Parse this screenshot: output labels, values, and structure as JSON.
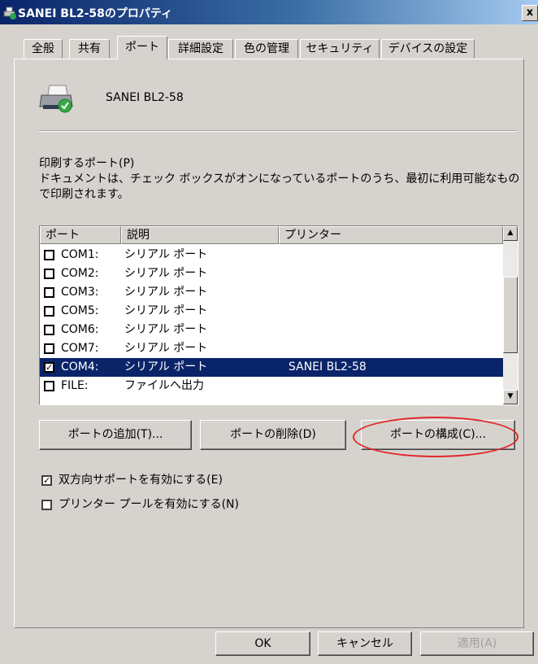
{
  "window": {
    "title": "SANEI BL2-58のプロパティ",
    "close_glyph": "x"
  },
  "tabs": [
    {
      "label": "全般"
    },
    {
      "label": "共有"
    },
    {
      "label": "ポート"
    },
    {
      "label": "詳細設定"
    },
    {
      "label": "色の管理"
    },
    {
      "label": "セキュリティ"
    },
    {
      "label": "デバイスの設定"
    }
  ],
  "active_tab": "ポート",
  "printer": {
    "name": "SANEI BL2-58",
    "icon": "printer-icon"
  },
  "ports_section": {
    "label": "印刷するポート(P)",
    "desc_line1": "ドキュメントは、チェック ボックスがオンになっているポートのうち、最初に利用可能なもの",
    "desc_line2": "で印刷されます。"
  },
  "port_list": {
    "columns": [
      "ポート",
      "説明",
      "プリンター"
    ],
    "rows": [
      {
        "port": "COM1:",
        "desc": "シリアル ポート",
        "printer": "",
        "checked": false,
        "selected": false
      },
      {
        "port": "COM2:",
        "desc": "シリアル ポート",
        "printer": "",
        "checked": false,
        "selected": false
      },
      {
        "port": "COM3:",
        "desc": "シリアル ポート",
        "printer": "",
        "checked": false,
        "selected": false
      },
      {
        "port": "COM5:",
        "desc": "シリアル ポート",
        "printer": "",
        "checked": false,
        "selected": false
      },
      {
        "port": "COM6:",
        "desc": "シリアル ポート",
        "printer": "",
        "checked": false,
        "selected": false
      },
      {
        "port": "COM7:",
        "desc": "シリアル ポート",
        "printer": "",
        "checked": false,
        "selected": false
      },
      {
        "port": "COM4:",
        "desc": "シリアル ポート",
        "printer": "SANEI BL2-58",
        "checked": true,
        "selected": true
      },
      {
        "port": "FILE:",
        "desc": "ファイルへ出力",
        "printer": "",
        "checked": false,
        "selected": false
      }
    ]
  },
  "buttons": {
    "add_port": "ポートの追加(T)...",
    "delete_port": "ポートの削除(D)",
    "configure_port": "ポートの構成(C)..."
  },
  "options": {
    "bidirectional": {
      "label": "双方向サポートを有効にする(E)",
      "checked": true
    },
    "pooling": {
      "label": "プリンター プールを有効にする(N)",
      "checked": false
    }
  },
  "footer": {
    "ok": "OK",
    "cancel": "キャンセル",
    "apply": "適用(A)"
  },
  "colors": {
    "titlebar": "#0a246a",
    "selection": "#0a246a",
    "highlight_oval": "#e3262a",
    "face": "#d6d3ce"
  }
}
